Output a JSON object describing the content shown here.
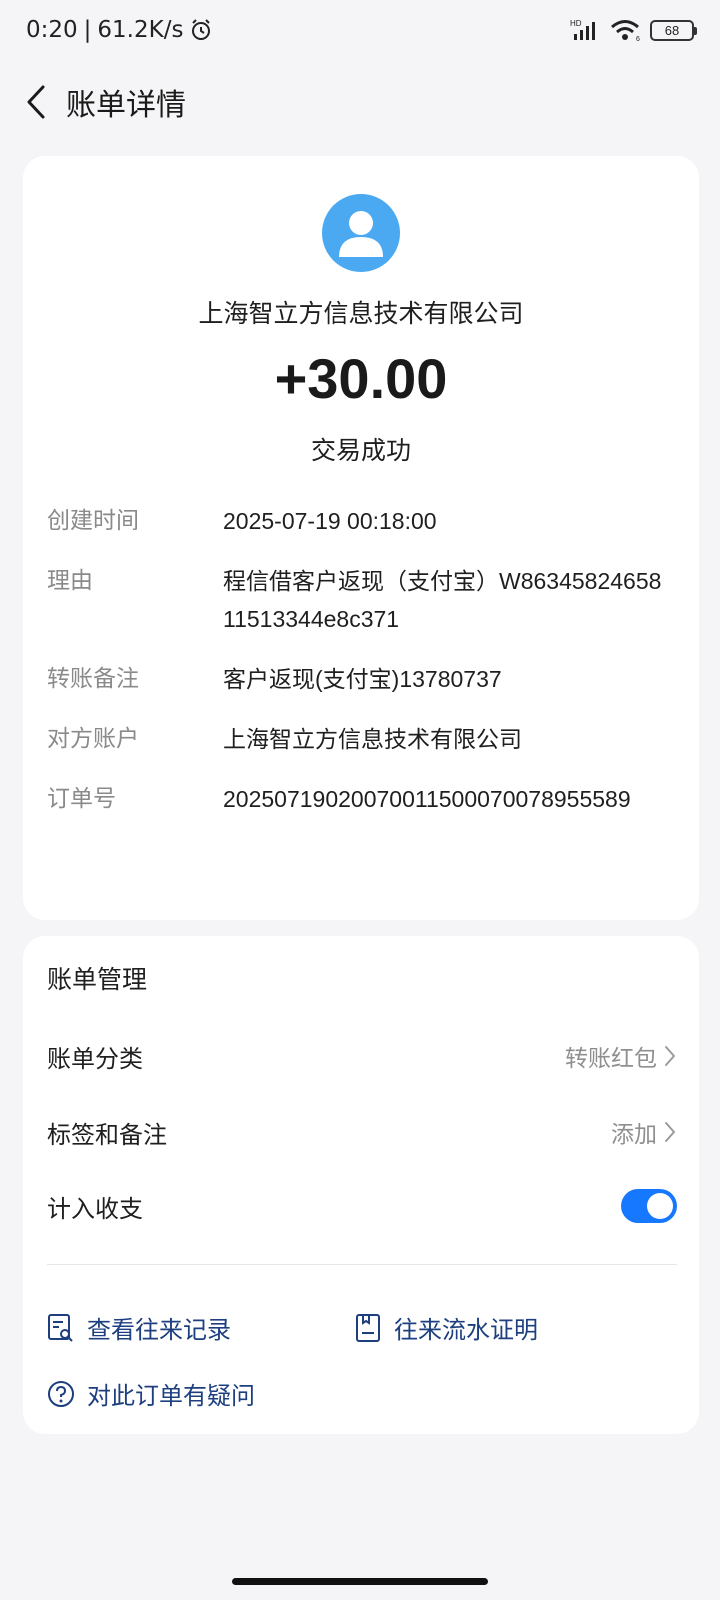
{
  "status_bar": {
    "time": "0:20",
    "speed": "61.2K/s",
    "battery": "68"
  },
  "header": {
    "title": "账单详情"
  },
  "transaction": {
    "payer": "上海智立方信息技术有限公司",
    "amount": "+30.00",
    "status": "交易成功"
  },
  "details": [
    {
      "label": "创建时间",
      "value": "2025-07-19 00:18:00"
    },
    {
      "label": "理由",
      "value": "程信借客户返现（支付宝）W8634582465811513344e8c371"
    },
    {
      "label": "转账备注",
      "value": "客户返现(支付宝)13780737"
    },
    {
      "label": "对方账户",
      "value": "上海智立方信息技术有限公司"
    },
    {
      "label": "订单号",
      "value": "20250719020070011500070078955589"
    }
  ],
  "management": {
    "title": "账单管理",
    "category_label": "账单分类",
    "category_value": "转账红包",
    "tags_label": "标签和备注",
    "tags_value": "添加",
    "income_label": "计入收支",
    "income_toggle_on": true,
    "link_records": "查看往来记录",
    "link_proof": "往来流水证明",
    "link_question": "对此订单有疑问"
  },
  "colors": {
    "accent": "#1677ff",
    "link": "#1d3f80",
    "avatar": "#4aa9f0"
  },
  "icons": [
    "chevron-left-icon",
    "user-avatar-icon",
    "chevron-right-icon",
    "record-search-icon",
    "document-icon",
    "question-icon",
    "alarm-icon",
    "signal-icon",
    "wifi-icon",
    "battery-icon"
  ]
}
